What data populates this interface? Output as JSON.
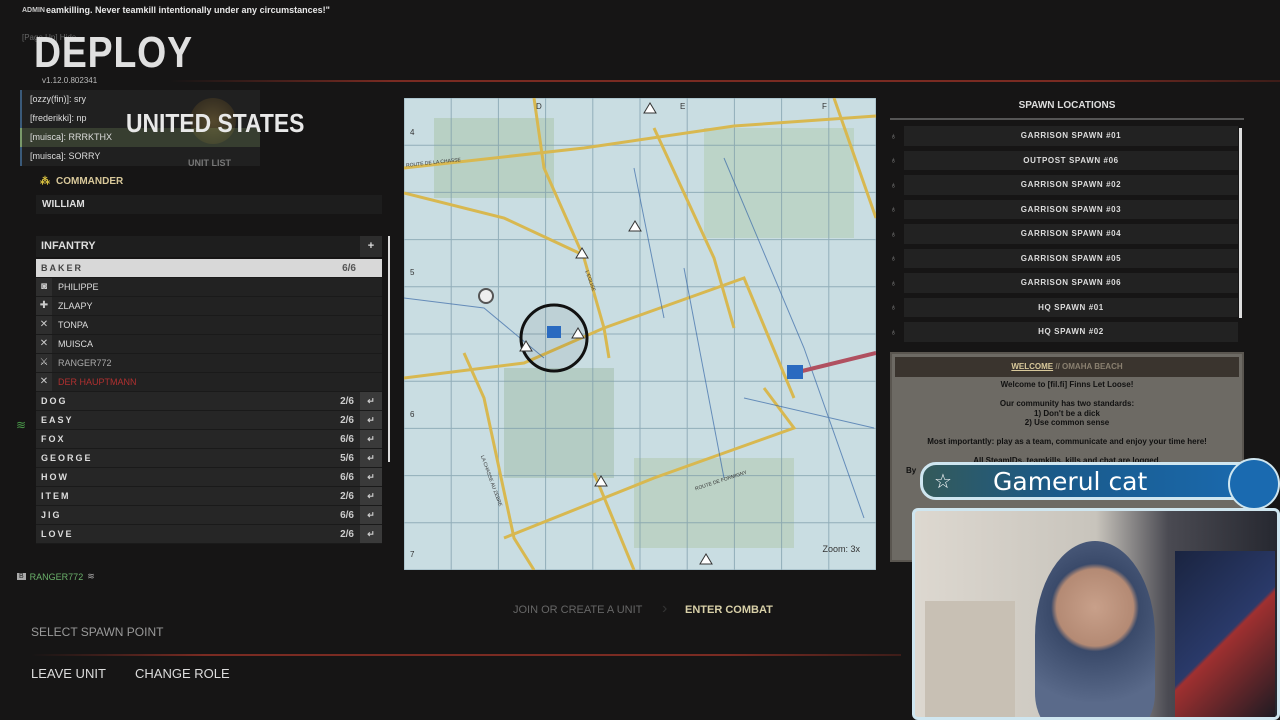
{
  "broadcast": {
    "tag": "ADMIN",
    "message": "eamkilling. Never teamkill intentionally under any circumstances!\"",
    "hint": "[Page Up] Hide"
  },
  "header": {
    "title": "DEPLOY",
    "version": "v1.12.0.802341",
    "faction": "UNITED STATES",
    "unit_list_label": "UNIT LIST"
  },
  "chat": [
    {
      "text": "[ozzy(fin)]: sry"
    },
    {
      "text": "[frederikki]: np"
    },
    {
      "text": "[muisca]: RRRKTHX"
    },
    {
      "text": "[muisca]: SORRY"
    }
  ],
  "commander": {
    "label": "COMMANDER",
    "name": "WILLIAM"
  },
  "infantry": {
    "label": "INFANTRY",
    "add": "+",
    "selected": {
      "name": "BAKER",
      "count": "6/6"
    },
    "members": [
      {
        "name": "PHILIPPE",
        "icon": "◙"
      },
      {
        "name": "ZLAAPY",
        "icon": "✚"
      },
      {
        "name": "TONPA",
        "icon": "✕"
      },
      {
        "name": "MUISCA",
        "icon": "✕"
      },
      {
        "name": "RANGER772",
        "icon": "⚔"
      },
      {
        "name": "DER HAUPTMANN",
        "icon": "✕"
      }
    ],
    "squads": [
      {
        "name": "DOG",
        "count": "2/6"
      },
      {
        "name": "EASY",
        "count": "2/6"
      },
      {
        "name": "FOX",
        "count": "6/6"
      },
      {
        "name": "GEORGE",
        "count": "5/6"
      },
      {
        "name": "HOW",
        "count": "6/6"
      },
      {
        "name": "ITEM",
        "count": "2/6"
      },
      {
        "name": "JIG",
        "count": "6/6"
      },
      {
        "name": "LOVE",
        "count": "2/6"
      }
    ],
    "join_icon": "↵",
    "lock_icon": "🔒"
  },
  "player": {
    "badge": "B",
    "name": "RANGER772"
  },
  "map": {
    "zoom": "Zoom: 3x",
    "cols": [
      "D",
      "E",
      "F"
    ],
    "rows": [
      "4",
      "5",
      "6",
      "7"
    ],
    "road_labels": [
      "ROUTE DE LA CHASSE",
      "ROUTE DE FORMIGNY",
      "LA CHASSE AU ZEBRE",
      "L'EGLISE"
    ]
  },
  "spawn": {
    "title": "SPAWN LOCATIONS",
    "items": [
      "GARRISON SPAWN #01",
      "OUTPOST SPAWN #06",
      "GARRISON SPAWN #02",
      "GARRISON SPAWN #03",
      "GARRISON SPAWN #04",
      "GARRISON SPAWN #05",
      "GARRISON SPAWN #06",
      "HQ SPAWN #01",
      "HQ SPAWN #02"
    ]
  },
  "welcome": {
    "tab_active": "WELCOME",
    "tab_sep": "//",
    "tab_other": "OMAHA BEACH",
    "lines": [
      "Welcome to [fil.fi] Finns Let Loose!",
      "",
      "Our community has two standards:",
      "1) Don't be a dick",
      "2) Use common sense",
      "",
      "Most importantly: play as a team, communicate and enjoy your time here!",
      "",
      "All SteamIDs, teamkills, kills and chat are logged.",
      "By"
    ]
  },
  "overlay": {
    "name": "Gamerul cat"
  },
  "footer": {
    "step1": "JOIN OR CREATE A UNIT",
    "step2": "ENTER COMBAT",
    "select_spawn": "SELECT SPAWN POINT",
    "leave": "LEAVE UNIT",
    "change_role": "CHANGE ROLE"
  }
}
